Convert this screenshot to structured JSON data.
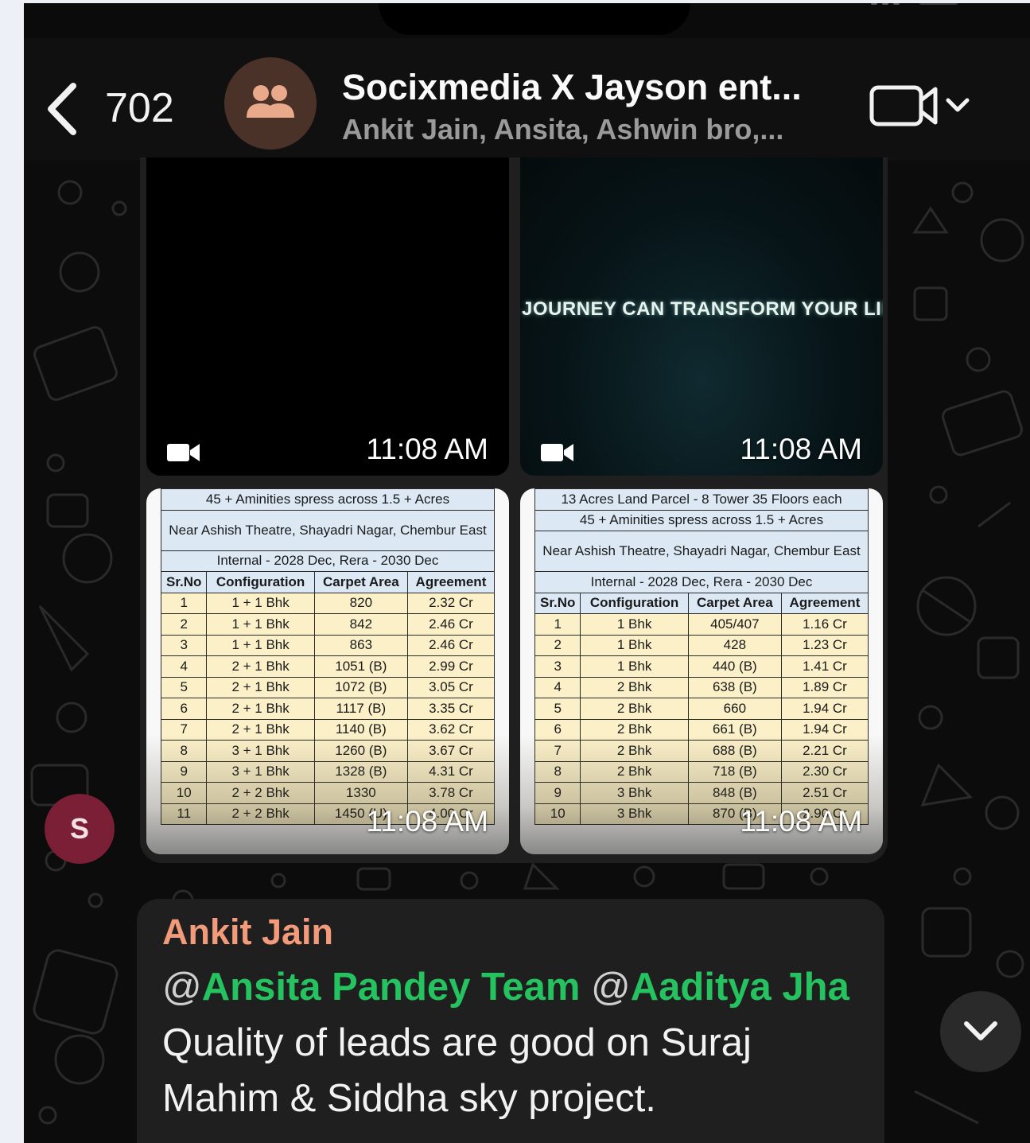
{
  "header": {
    "back_count": "702",
    "title": "Socixmedia X Jayson ent...",
    "members": "Ankit Jain, Ansita, Ashwin bro,..."
  },
  "media": {
    "video_1_time": "11:08 AM",
    "video_2_time": "11:08 AM",
    "video_2_caption": "JOURNEY CAN TRANSFORM YOUR LIFE",
    "image_1_time": "11:08 AM",
    "image_2_time": "11:08 AM",
    "sheet_1": {
      "info": [
        "45 + Aminities spress across 1.5 + Acres",
        "Near Ashish Theatre, Shayadri Nagar, Chembur East",
        "Internal - 2028 Dec, Rera - 2030 Dec"
      ],
      "headers": [
        "Sr.No",
        "Configuration",
        "Carpet Area",
        "Agreement"
      ],
      "rows": [
        [
          "1",
          "1 + 1 Bhk",
          "820",
          "2.32 Cr"
        ],
        [
          "2",
          "1 + 1 Bhk",
          "842",
          "2.46 Cr"
        ],
        [
          "3",
          "1 + 1 Bhk",
          "863",
          "2.46 Cr"
        ],
        [
          "4",
          "2 + 1 Bhk",
          "1051 (B)",
          "2.99 Cr"
        ],
        [
          "5",
          "2 + 1 Bhk",
          "1072 (B)",
          "3.05 Cr"
        ],
        [
          "6",
          "2 + 1 Bhk",
          "1117 (B)",
          "3.35 Cr"
        ],
        [
          "7",
          "2 + 1 Bhk",
          "1140 (B)",
          "3.62 Cr"
        ],
        [
          "8",
          "3 + 1 Bhk",
          "1260 (B)",
          "3.67 Cr"
        ],
        [
          "9",
          "3 + 1 Bhk",
          "1328 (B)",
          "4.31 Cr"
        ],
        [
          "10",
          "2 + 2 Bhk",
          "1330",
          "3.78 Cr"
        ],
        [
          "11",
          "2 + 2 Bhk",
          "1450 (U)",
          "4.00 Cr"
        ]
      ]
    },
    "sheet_2": {
      "info": [
        "13 Acres Land Parcel - 8 Tower 35 Floors each",
        "45 + Aminities spress across 1.5 + Acres",
        "Near Ashish Theatre, Shayadri Nagar, Chembur East",
        "Internal - 2028 Dec, Rera - 2030 Dec"
      ],
      "headers": [
        "Sr.No",
        "Configuration",
        "Carpet Area",
        "Agreement"
      ],
      "rows": [
        [
          "1",
          "1 Bhk",
          "405/407",
          "1.16 Cr"
        ],
        [
          "2",
          "1 Bhk",
          "428",
          "1.23 Cr"
        ],
        [
          "3",
          "1 Bhk",
          "440 (B)",
          "1.41 Cr"
        ],
        [
          "4",
          "2 Bhk",
          "638 (B)",
          "1.89 Cr"
        ],
        [
          "5",
          "2 Bhk",
          "660",
          "1.94 Cr"
        ],
        [
          "6",
          "2 Bhk",
          "661 (B)",
          "1.94 Cr"
        ],
        [
          "7",
          "2 Bhk",
          "688 (B)",
          "2.21 Cr"
        ],
        [
          "8",
          "2 Bhk",
          "718 (B)",
          "2.30 Cr"
        ],
        [
          "9",
          "3 Bhk",
          "848 (B)",
          "2.51 Cr"
        ],
        [
          "10",
          "3 Bhk",
          "870 (B)",
          "2.90 Cr"
        ]
      ]
    }
  },
  "sender_avatar_letter": "S",
  "message": {
    "sender": "Ankit Jain",
    "at_1": "@",
    "mention_1": "Ansita Pandey Team",
    "at_2": "@",
    "mention_2": "Aaditya Jha",
    "text": "Quality of leads are good on Suraj Mahim & Siddha sky project."
  },
  "colors": {
    "sender_name": "#f29a7a",
    "mention": "#25c35f",
    "avatar_bg": "#7a1f35"
  },
  "icons": {
    "back": "chevron-left-icon",
    "group": "group-icon",
    "video_call": "video-camera-icon",
    "video_badge": "video-camera-icon",
    "scroll_down": "chevron-down-icon"
  }
}
